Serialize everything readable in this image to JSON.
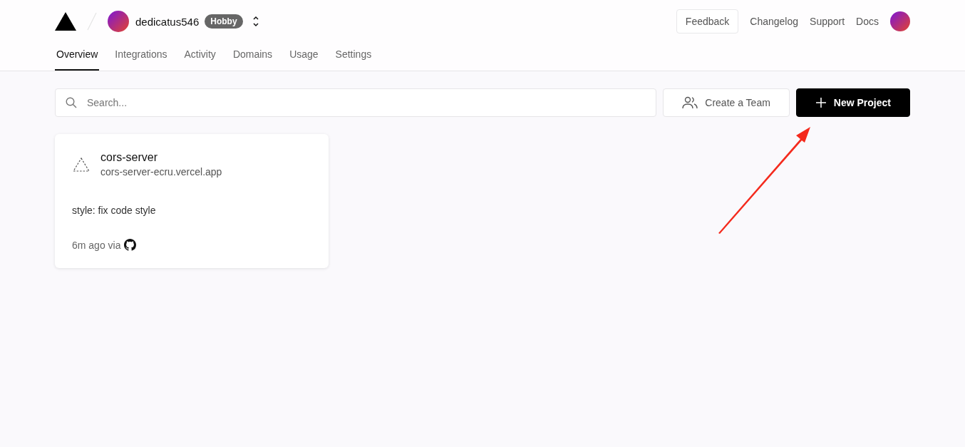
{
  "header": {
    "account": "dedicatus546",
    "plan": "Hobby",
    "links": [
      "Feedback",
      "Changelog",
      "Support",
      "Docs"
    ]
  },
  "tabs": [
    {
      "label": "Overview",
      "selected": true
    },
    {
      "label": "Integrations",
      "selected": false
    },
    {
      "label": "Activity",
      "selected": false
    },
    {
      "label": "Domains",
      "selected": false
    },
    {
      "label": "Usage",
      "selected": false
    },
    {
      "label": "Settings",
      "selected": false
    }
  ],
  "search": {
    "placeholder": "Search..."
  },
  "buttons": [
    {
      "label": "Create a Team",
      "kind": "secondary"
    },
    {
      "label": "New Project",
      "kind": "primary"
    }
  ],
  "projects": [
    {
      "name": "cors-server",
      "domain": "cors-server-ecru.vercel.app",
      "commit": "style: fix code style",
      "time": "6m ago via"
    }
  ]
}
